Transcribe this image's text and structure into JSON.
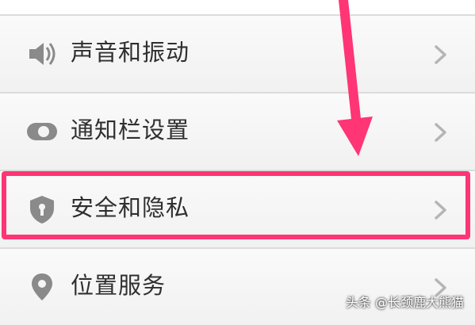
{
  "settings_list": {
    "items": [
      {
        "label": "声音和振动",
        "icon": "speaker-icon"
      },
      {
        "label": "通知栏设置",
        "icon": "toggle-icon"
      },
      {
        "label": "安全和隐私",
        "icon": "shield-icon"
      },
      {
        "label": "位置服务",
        "icon": "location-pin-icon"
      }
    ]
  },
  "annotation": {
    "highlight_color": "#ff3575",
    "arrow_color": "#ff3575"
  },
  "watermark": "头条 @长颈鹿大熊猫",
  "colors": {
    "row_bg": "#f4f4f4",
    "text": "#2f2f2f",
    "icon": "#8a8a8a",
    "chevron": "#b5b5b5"
  }
}
